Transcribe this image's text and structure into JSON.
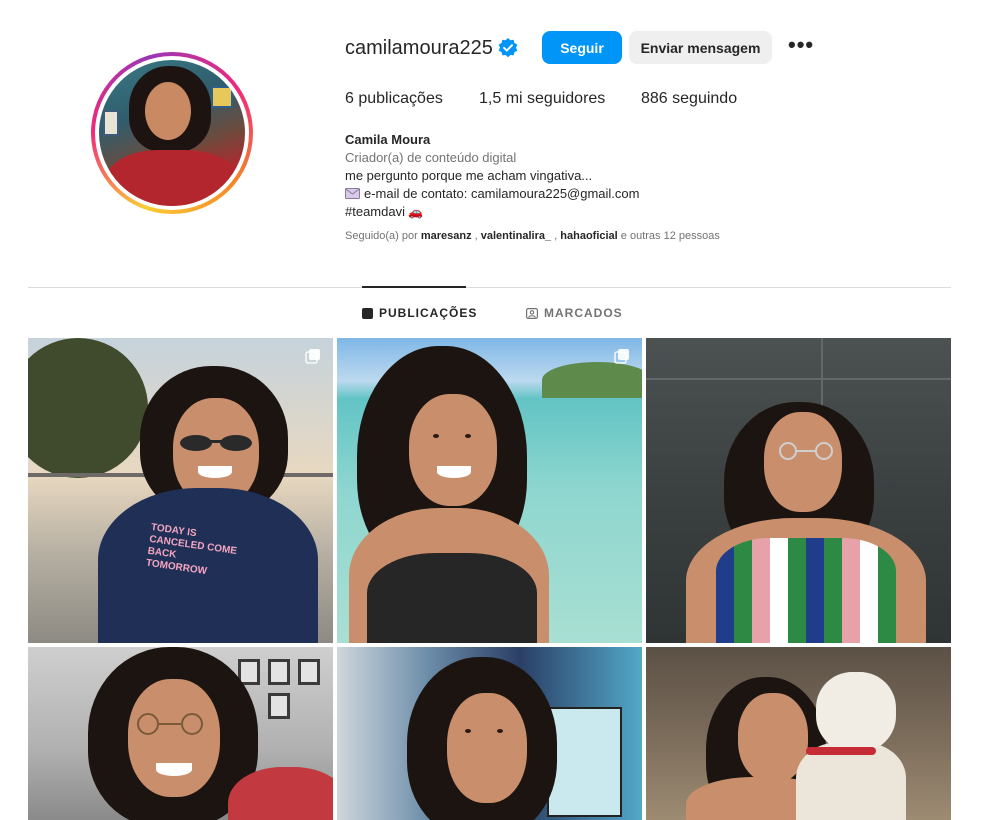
{
  "profile": {
    "username": "camilamoura225",
    "verified_icon": "verified-badge-icon",
    "follow_label": "Seguir",
    "message_label": "Enviar mensagem",
    "more_label": "•••",
    "avatar_icon": "profile-avatar"
  },
  "stats": {
    "posts": "6 publicações",
    "followers": "1,5 mi seguidores",
    "following": "886 seguindo"
  },
  "bio": {
    "name": "Camila Moura",
    "category": "Criador(a) de conteúdo digital",
    "line1": "me pergunto porque me acham vingativa...",
    "line2": "e-mail de contato: camilamoura225@gmail.com",
    "line3": "#teamdavi",
    "line3_emoji": "🚗"
  },
  "followed_by": {
    "prefix": "Seguido(a) por ",
    "user1": "maresanz",
    "sep1": " , ",
    "user2": "valentinalira_",
    "sep2": " , ",
    "user3": "hahaoficial",
    "suffix": " e outras 12 pessoas"
  },
  "tabs": {
    "posts": "PUBLICAÇÕES",
    "tagged": "MARCADOS"
  },
  "colors": {
    "accent": "#0095f6",
    "text": "#262626",
    "secondary_text": "#737373",
    "divider": "#dbdbdb"
  },
  "posts": [
    {
      "id": "post-1",
      "shirt_text": "TODAY IS CANCELED COME BACK TOMORROW",
      "multi": true
    },
    {
      "id": "post-2",
      "multi": true
    },
    {
      "id": "post-3",
      "multi": false
    },
    {
      "id": "post-4",
      "multi": false
    },
    {
      "id": "post-5",
      "multi": false
    },
    {
      "id": "post-6",
      "multi": false
    }
  ]
}
